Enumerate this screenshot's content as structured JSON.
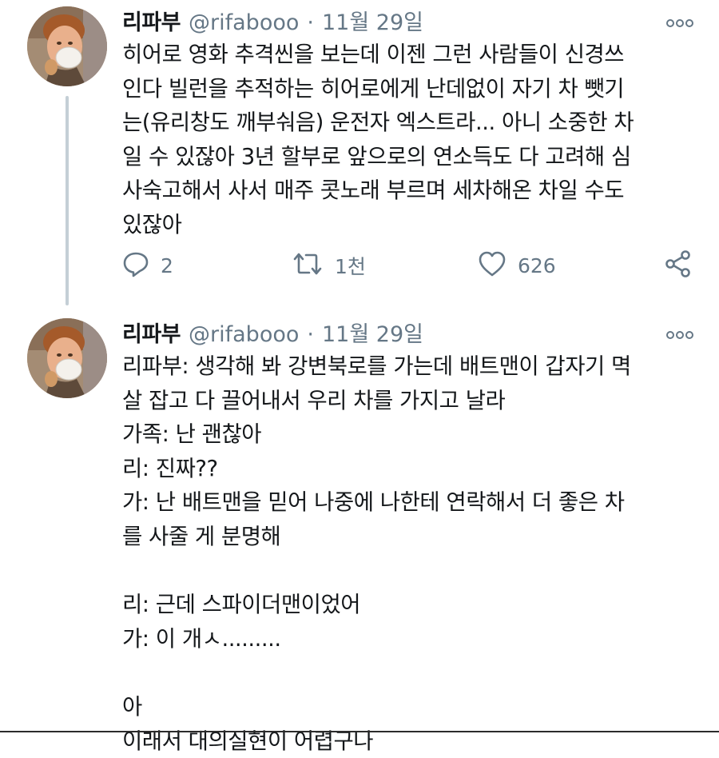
{
  "tweets": [
    {
      "name": "리파부",
      "handle": "@rifabooo",
      "separator": "·",
      "date": "11월 29일",
      "lines": [
        "히어로 영화 추격씬을 보는데 이젠 그런 사람들이 신경쓰",
        "인다 빌런을 추적하는 히어로에게 난데없이 자기 차 뺏기",
        "는(유리창도 깨부숴음) 운전자 엑스트라... 아니 소중한 차",
        "일 수 있잖아 3년 할부로 앞으로의 연소득도 다 고려해 심",
        "사숙고해서 사서 매주 콧노래 부르며 세차해온 차일 수도",
        "있잖아"
      ],
      "replies": "2",
      "retweets": "1천",
      "likes": "626"
    },
    {
      "name": "리파부",
      "handle": "@rifabooo",
      "separator": "·",
      "date": "11월 29일",
      "lines": [
        "리파부: 생각해 봐 강변북로를 가는데 배트맨이 갑자기 멱",
        "살 잡고 다 끌어내서 우리 차를 가지고 날라",
        "가족: 난 괜찮아",
        "리: 진짜??",
        "가: 난 배트맨을 믿어 나중에 나한테 연락해서 더 좋은 차",
        "를 사줄 게 분명해",
        "",
        "리: 근데 스파이더맨이었어",
        "가: 이 개ㅅ.........",
        "",
        "아",
        "이래서 대의실현이 어렵구나"
      ]
    }
  ],
  "icons": {
    "more": "more-icon",
    "reply": "reply-icon",
    "retweet": "retweet-icon",
    "like": "heart-icon",
    "share": "share-icon"
  },
  "colors": {
    "text": "#14171a",
    "muted": "#657786",
    "thread_line": "#c4cfd6"
  }
}
